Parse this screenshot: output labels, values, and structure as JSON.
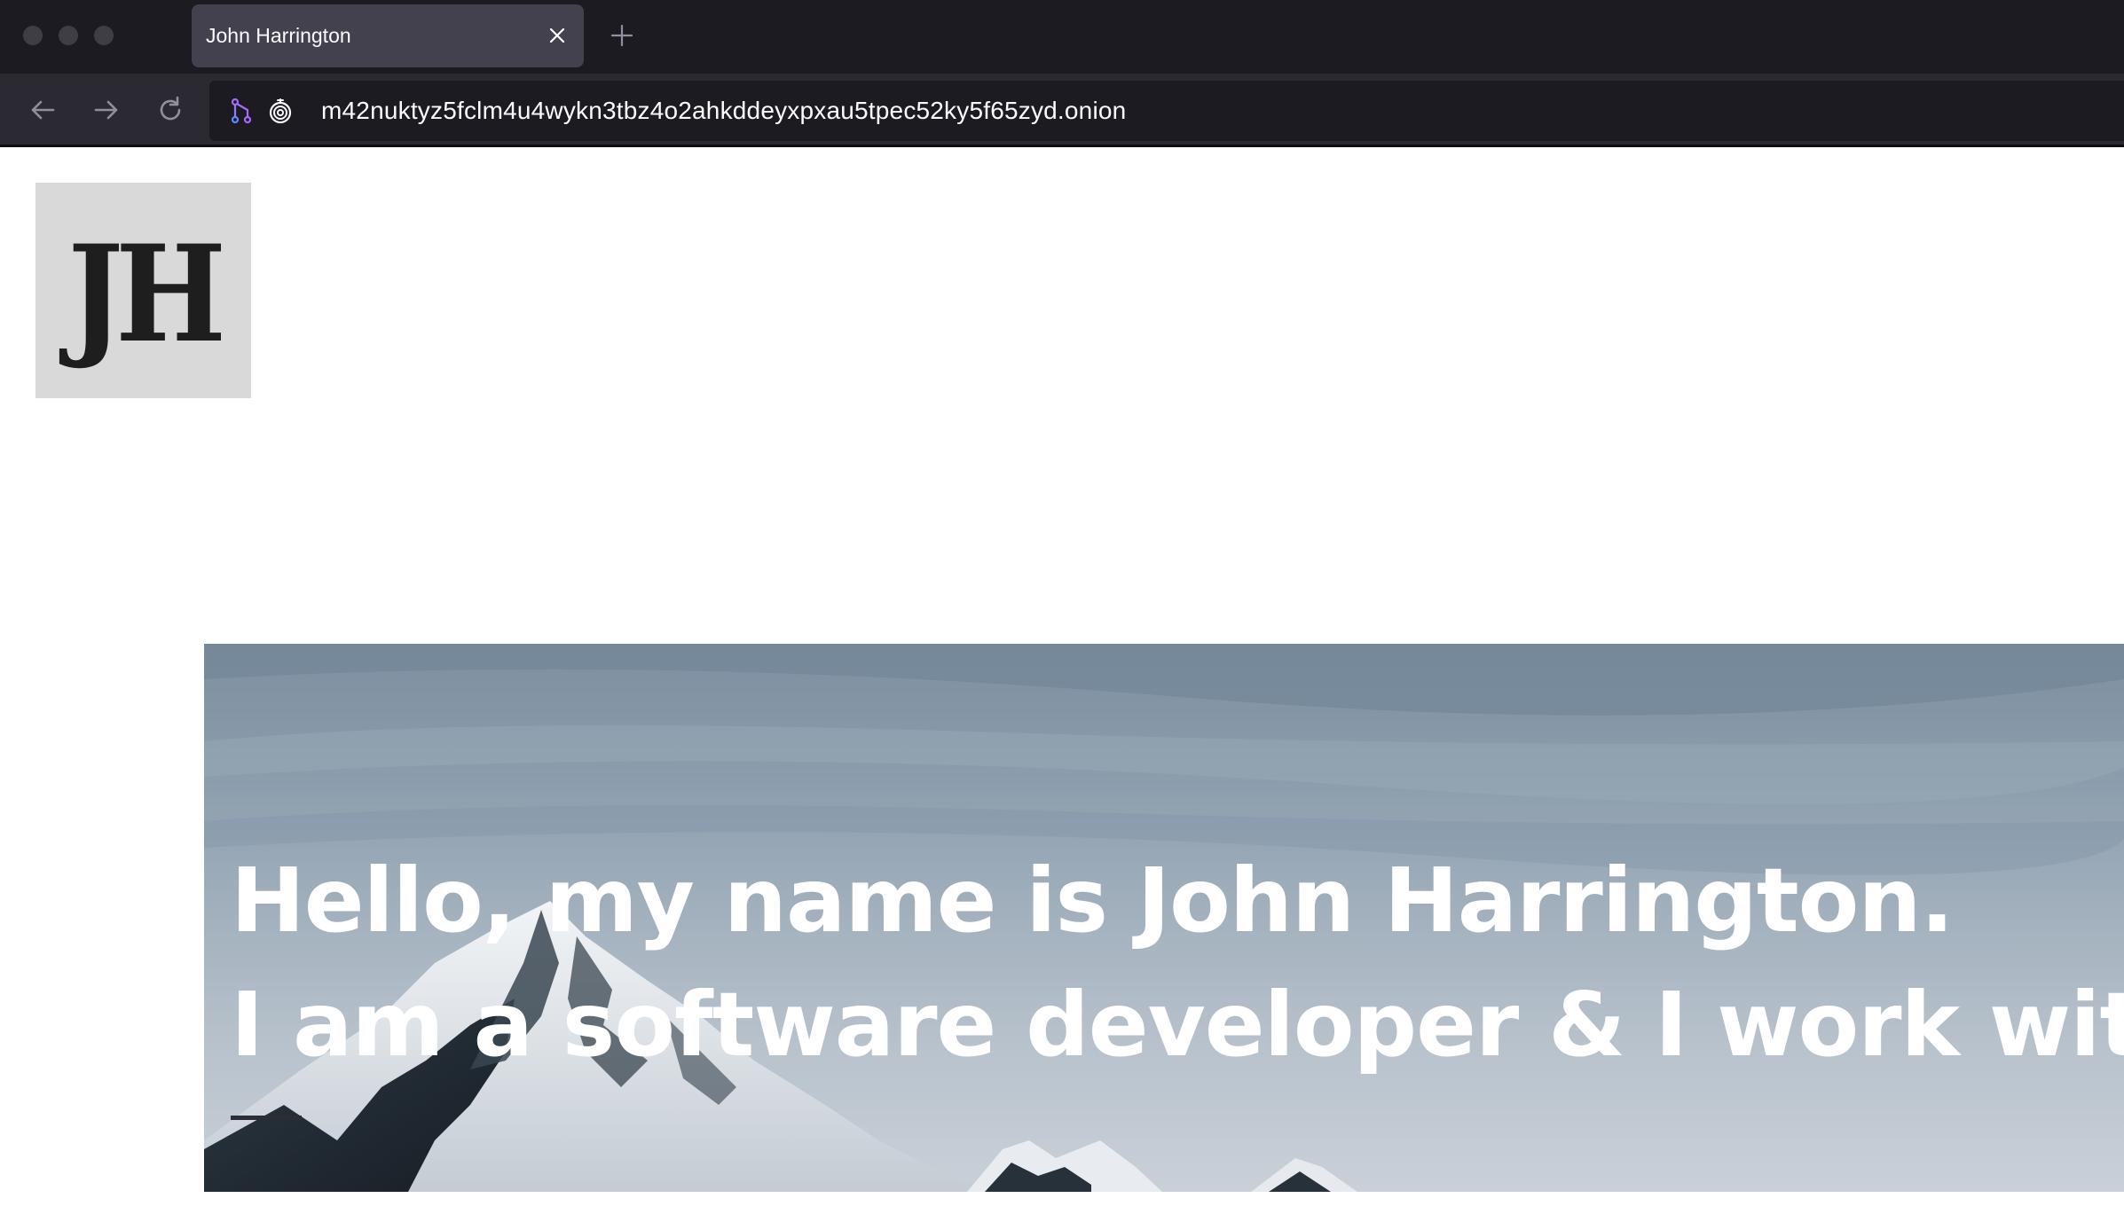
{
  "browser": {
    "tab_title": "John Harrington",
    "url": "m42nuktyz5fclm4u4wykn3tbz4o2ahkddeyxpxau5tpec52ky5f65zyd.onion",
    "icons": {
      "tab_close": "close-icon",
      "new_tab": "plus-icon",
      "back": "arrow-left-icon",
      "forward": "arrow-right-icon",
      "reload": "reload-icon",
      "circuit": "tor-circuit-icon",
      "onion": "onion-icon"
    },
    "colors": {
      "titlebar": "#1c1b22",
      "tab_active": "#42414d",
      "toolbar": "#2b2a33",
      "urlbar": "#1c1b22",
      "circuit_icon": "#a66cff"
    }
  },
  "page": {
    "logo_text": "JH",
    "hero": {
      "line1": "Hello, my name is John Harrington.",
      "line2": "I am a software developer & I work with:"
    }
  }
}
